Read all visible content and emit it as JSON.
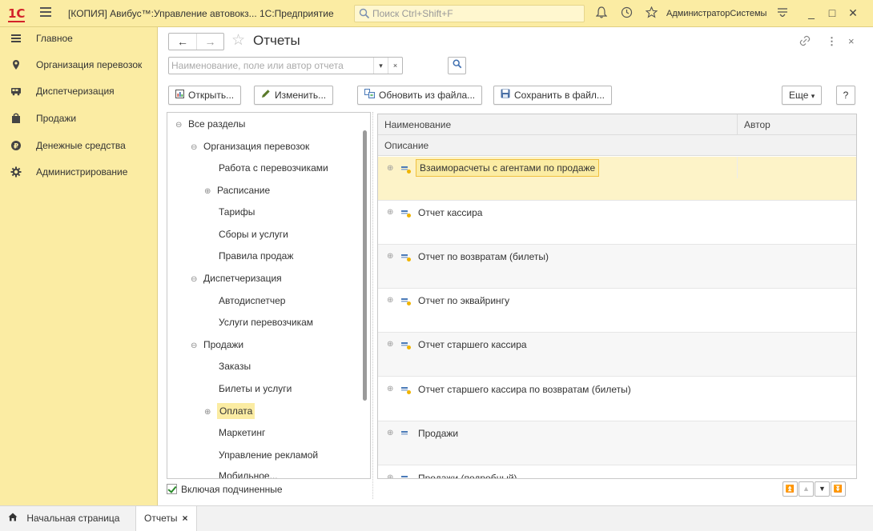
{
  "titlebar": {
    "logo": "1С",
    "title": "[КОПИЯ] Авибус™:Управление автовокз... 1С:Предприятие",
    "search_placeholder": "Поиск Ctrl+Shift+F",
    "user": "АдминистраторСистемы",
    "icons": [
      "bell-icon",
      "history-icon",
      "favorites-star-icon",
      "settings-icon",
      "minimize-icon",
      "maximize-icon",
      "close-icon"
    ]
  },
  "sidebar": {
    "items": [
      {
        "label": "Главное",
        "icon": "menu-lines-icon"
      },
      {
        "label": "Организация перевозок",
        "icon": "location-pin-icon"
      },
      {
        "label": "Диспетчеризация",
        "icon": "bus-icon"
      },
      {
        "label": "Продажи",
        "icon": "shopping-bag-icon"
      },
      {
        "label": "Денежные средства",
        "icon": "money-icon"
      },
      {
        "label": "Администрирование",
        "icon": "gear-icon"
      }
    ]
  },
  "page": {
    "title": "Отчеты",
    "back": "←",
    "forward": "→"
  },
  "search": {
    "placeholder": "Наименование, поле или автор отчета",
    "dropdown": "▾",
    "clear": "×"
  },
  "toolbar": {
    "open": "Открыть...",
    "edit": "Изменить...",
    "update_from_file": "Обновить из файла...",
    "save_to_file": "Сохранить в файл...",
    "more": "Еще",
    "help": "?"
  },
  "tree": {
    "items": [
      {
        "label": "Все разделы",
        "toggle": "⊖"
      },
      {
        "label": "Организация перевозок",
        "toggle": "⊖"
      },
      {
        "label": "Работа с перевозчиками",
        "toggle": ""
      },
      {
        "label": "Расписание",
        "toggle": "⊕"
      },
      {
        "label": "Тарифы",
        "toggle": ""
      },
      {
        "label": "Сборы и услуги",
        "toggle": ""
      },
      {
        "label": "Правила продаж",
        "toggle": ""
      },
      {
        "label": "Диспетчеризация",
        "toggle": "⊖"
      },
      {
        "label": "Автодиспетчер",
        "toggle": ""
      },
      {
        "label": "Услуги перевозчикам",
        "toggle": ""
      },
      {
        "label": "Продажи",
        "toggle": "⊖"
      },
      {
        "label": "Заказы",
        "toggle": ""
      },
      {
        "label": "Билеты и услуги",
        "toggle": ""
      },
      {
        "label": "Оплата",
        "toggle": "⊕"
      },
      {
        "label": "Маркетинг",
        "toggle": ""
      },
      {
        "label": "Управление рекламой",
        "toggle": ""
      },
      {
        "label": "Мобильное...",
        "toggle": ""
      }
    ],
    "include_sub": "Включая подчиненные"
  },
  "table": {
    "headers": {
      "name": "Наименование",
      "author": "Автор",
      "description": "Описание"
    },
    "rows": [
      {
        "name": "Взаиморасчеты с агентами по продаже"
      },
      {
        "name": "Отчет кассира"
      },
      {
        "name": "Отчет по возвратам (билеты)"
      },
      {
        "name": "Отчет по эквайрингу"
      },
      {
        "name": "Отчет старшего кассира"
      },
      {
        "name": "Отчет старшего кассира по возвратам (билеты)"
      },
      {
        "name": "Продажи"
      },
      {
        "name": "Продажи (подробный)"
      }
    ]
  },
  "bottom_tabs": {
    "home": "Начальная страница",
    "reports": "Отчеты"
  },
  "colors": {
    "accent_yellow": "#fbeca3",
    "selected_row": "#fdf3c8",
    "logo_red": "#d3222a"
  }
}
